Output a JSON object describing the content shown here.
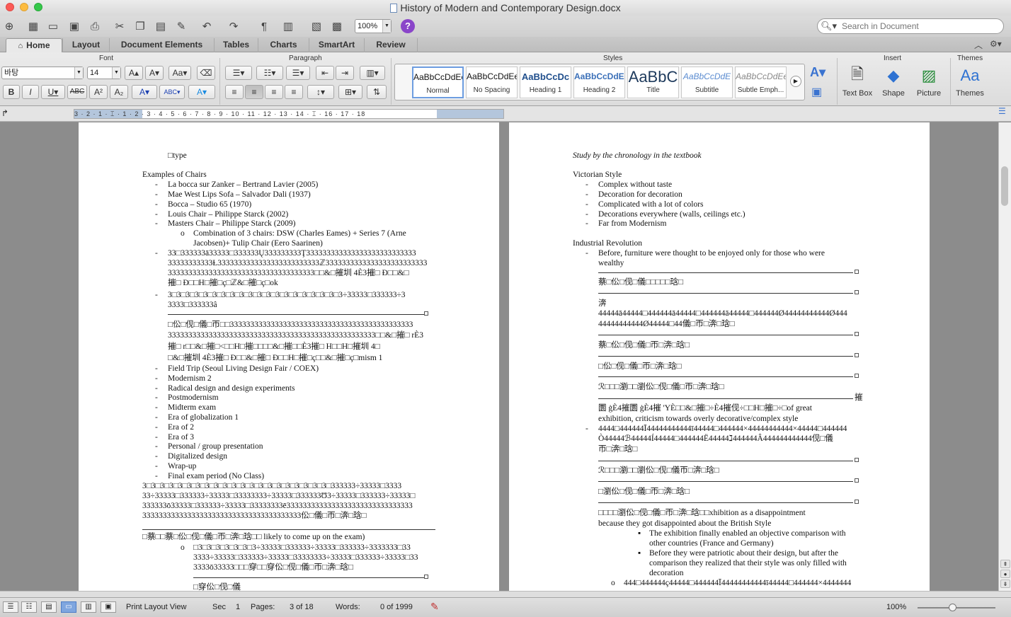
{
  "window": {
    "title": "History of Modern and Contemporary Design.docx"
  },
  "toolbar": {
    "zoom": "100%",
    "search_placeholder": "Search in Document"
  },
  "ribbon_tabs": [
    "Home",
    "Layout",
    "Document Elements",
    "Tables",
    "Charts",
    "SmartArt",
    "Review"
  ],
  "ribbon": {
    "font_group": "Font",
    "paragraph_group": "Paragraph",
    "styles_group": "Styles",
    "insert_group": "Insert",
    "themes_group": "Themes",
    "font_name": "바탕",
    "font_size": "14",
    "styles": [
      {
        "sample": "AaBbCcDdEe",
        "name": "Normal"
      },
      {
        "sample": "AaBbCcDdEe",
        "name": "No Spacing"
      },
      {
        "sample": "AaBbCcDc",
        "name": "Heading 1"
      },
      {
        "sample": "AaBbCcDdEe",
        "name": "Heading 2"
      },
      {
        "sample": "AaBbC",
        "name": "Title"
      },
      {
        "sample": "AaBbCcDdE",
        "name": "Subtitle"
      },
      {
        "sample": "AaBbCcDdEe",
        "name": "Subtle Emph..."
      }
    ],
    "insert_buttons": [
      "Text Box",
      "Shape",
      "Picture"
    ],
    "themes_button": "Themes"
  },
  "ruler": {
    "numbers": "3 · 2 · 1 · ⌶ · 1 · 2 · 3 · 4 · 5 · 6 · 7 · 8 · 9 · 10 · 11 · 12 · 13 · 14 · ⌶ · 16 · 17 · 18"
  },
  "left_page": {
    "type_line": "□type",
    "heading_chairs": "Examples of Chairs",
    "chairs": [
      "La bocca sur Zanker – Bertrand Lavier (2005)",
      "Mae West Lips Sofa – Salvador Dali (1937)",
      "Bocca – Studio 65 (1970)",
      "Louis Chair – Philippe Starck (2002)",
      "Masters Chair – Philippe Starck (2009)"
    ],
    "masters_sub_1": "Combination of 3 chairs: DSW (Charles Eames) + Series 7 (Arne",
    "masters_sub_2": "Jacobsen)+ Tulip Chair (Eero Saarinen)",
    "garbled_a": [
      "33□333333ā33333□333333Ų333333333Ţ333333333333333333333333333",
      "33333333333Ɫ3333333333333333333333333ℤ3333333333333333333333333",
      "333333333333333333333333333333333333□□&□摧圳 4È3摧□ Ð□□&□",
      "摧□ Ð□□H□摧□ç□ℤ&□摧□ç□ok"
    ],
    "garbled_b": [
      "3□3□3□3□3□3□3□3□3□3□3□3□3□3□3□3□3□3□3□3÷33333□333333÷3",
      "3333□333333â"
    ],
    "garbled_c": [
      "□伀□伣□儀□帀□□333333333333333333333333333333333333333333333",
      "333333333333333333333333333333333333333333333333333□□&□摧□ rÈ3",
      "摧□ r□□&□摧□<□□H□摧□□□□&□摧□□È3摧□ H□□H□摧圳 4□",
      "□&□摧圳 4È3摧□ Ð□□&□摧□ Ð□□H□摧□ç□□&□摧□ç□mism 1"
    ],
    "topics": [
      "Field Trip (Seoul Living Design Fair / COEX)",
      "Modernism 2",
      "Radical design and design experiments",
      "Postmodernism",
      "Midterm exam",
      "Era of globalization 1",
      "Era of 2",
      "Era of 3",
      "Personal / group presentation",
      "Digitalized design",
      "Wrap-up",
      "Final exam period (No Class)"
    ],
    "garbled_d": [
      "3□3□3□3□3□3□3□3□3□3□3□3□3□3□3□3□3□3□3□3□3□333333÷33333□3333",
      "33÷33333□333333÷33333□33333333÷33333□333333Ʊ3÷33333□333333÷33333□",
      "333333ō33333□333333÷33333□33333333ē3333333333333333333333333333333",
      "333333333333333333333333333333333333333伀□儀□帀□渀□琀□"
    ],
    "exam_line": "□蔡□□蔡□伀□伣□儀□帀□渀□琀□□ likely to come up on the exam)",
    "garbled_e": [
      "□3□3□3□3□3□3□3÷33333□333333÷33333□333333÷3333333□33",
      "3333÷33333□333333÷33333□33333333÷33333□333333÷33333□33",
      "3333ō33333□□□穿□□穿伀□伣□儀□帀□渀□琀□"
    ],
    "bottom_line": "□穿伀□伣□儀"
  },
  "right_page": {
    "study_note": "Study by the chronology in the textbook",
    "victorian_heading": "Victorian Style",
    "victorian_items": [
      "Complex without taste",
      "Decoration for decoration",
      "Complicated with a lot of colors",
      "Decorations everywhere (walls, ceilings etc.)",
      "Far from Modernism"
    ],
    "industrial_heading": "Industrial Revolution",
    "industrial_item_1": "Before, furniture were thought to be enjoyed only for those who were",
    "industrial_item_1b": "wealthy",
    "g1": "蔡□伀□伣□儀□□□□□琀□",
    "g2": "渀",
    "g3a": "44444ā44444□444444ā44444□444444ā44444□444444Ø44444444444Ø444",
    "g3b": "44444444444Ø44444□44儀□帀□渀□琀□",
    "g4": "蔡□伀□伣□儀□帀□渀□琀□",
    "g5": "□伀□伣□儀□帀□渀□琀□",
    "g6": "ℛ□□□瀏□□瀏伀□伣□儀□帀□渀□琀□",
    "great_a": "圜 ġÈ4摧圜 ġÈ4摧 'YÈ□□&□摧□÷È4摧伣÷□□H□摧□÷□of great",
    "great_b": "exhibition, criticism towards overly decorative/complex style",
    "g7a": "4444□444444Ī44444444444ī44444□444444×44444444444×44444□444444",
    "g7b": "Ò44444ℬ44444Í44444□444444Ë44444ℷ444444Â444444444444伣□儀",
    "g7c": "帀□渀□琀□",
    "g8": "ℛ□□□瀏□□瀏伀□伣□儀帀□渀□琀□",
    "g9": "□瀏伀□伣□儀□帀□渀□琀□",
    "exh_a": "□□□□瀏伀□伣□儀□帀□渀□琀□□xhibition as a disappointment",
    "exh_b": "because they got disappointed about the British Style",
    "bullet1a": "The exhibition finally enabled an objective comparison with",
    "bullet1b": "other countries (France and Germany)",
    "bullet2a": "Before they were patriotic about their design, but after the",
    "bullet2b": "comparison they realized that their style was only filled with",
    "bullet2c": "decoration",
    "last": "444□444444ç44444□444444Ī44444444444ī44444□444444×4444444",
    "side_glyph": "摧"
  },
  "status": {
    "view_name": "Print Layout View",
    "sec_label": "Sec",
    "sec_value": "1",
    "pages_label": "Pages:",
    "pages_value": "3 of 18",
    "words_label": "Words:",
    "words_value": "0 of 1999",
    "zoom": "100%"
  }
}
